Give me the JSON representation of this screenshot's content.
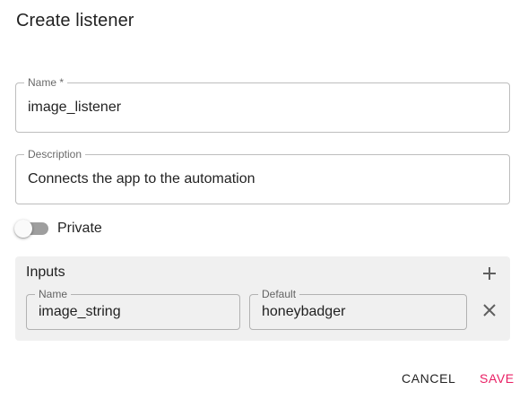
{
  "dialog": {
    "title": "Create listener"
  },
  "fields": {
    "name": {
      "label": "Name *",
      "value": "image_listener"
    },
    "description": {
      "label": "Description",
      "value": "Connects the app to the automation"
    }
  },
  "private_switch": {
    "label": "Private",
    "checked": false
  },
  "inputs_panel": {
    "title": "Inputs",
    "add_icon": "plus-icon",
    "rows": [
      {
        "name_label": "Name",
        "name_value": "image_string",
        "default_label": "Default",
        "default_value": "honeybadger",
        "remove_icon": "close-icon"
      }
    ]
  },
  "actions": {
    "cancel_label": "CANCEL",
    "save_label": "SAVE"
  },
  "colors": {
    "accent": "#e91e63",
    "panel_bg": "#f0f0f0",
    "switch_track": "#9e9e9e"
  }
}
